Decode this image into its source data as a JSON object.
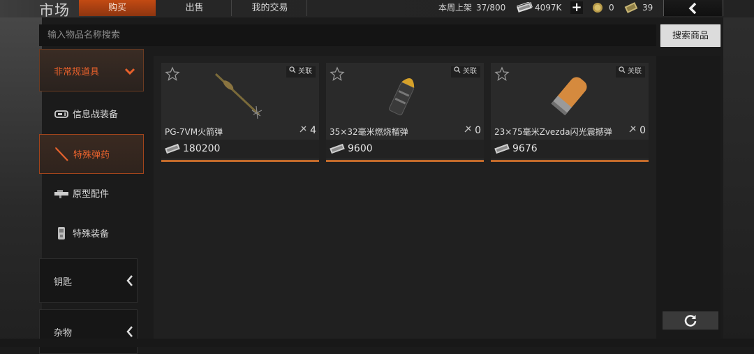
{
  "header": {
    "title": "市场",
    "tabs": [
      {
        "label": "购买",
        "active": true
      },
      {
        "label": "出售",
        "active": false
      },
      {
        "label": "我的交易",
        "active": false
      }
    ],
    "weekly_listed_label": "本周上架",
    "weekly_listed_value": "37/800",
    "currency_amount": "4097K",
    "coin_count": "0",
    "ticket_count": "39",
    "icons": {
      "currency": "cash-icon",
      "coin": "coin-icon",
      "ticket": "ticket-icon",
      "back": "back-arrow-icon"
    }
  },
  "search": {
    "placeholder": "输入物品名称搜索",
    "button_label": "搜索商品"
  },
  "sidebar": {
    "category_title": "非常规道具",
    "items": [
      {
        "label": "信息战装备",
        "icon": "device-icon",
        "active": false
      },
      {
        "label": "特殊弹药",
        "icon": "ammo-icon",
        "active": true
      },
      {
        "label": "原型配件",
        "icon": "attachment-icon",
        "active": false
      },
      {
        "label": "特殊装备",
        "icon": "equipment-icon",
        "active": false
      }
    ],
    "groups": [
      {
        "label": "钥匙"
      },
      {
        "label": "杂物"
      }
    ]
  },
  "listings": [
    {
      "name": "PG-7VM火箭弹",
      "related_label": "关联",
      "stock": "4",
      "price": "180200",
      "icon": "rocket-icon"
    },
    {
      "name": "35×32毫米燃烧榴弹",
      "related_label": "关联",
      "stock": "0",
      "price": "9600",
      "icon": "grenade-round-icon"
    },
    {
      "name": "23×75毫米Zvezda闪光震撼弹",
      "related_label": "关联",
      "stock": "0",
      "price": "9676",
      "icon": "shotgun-shell-icon"
    }
  ],
  "colors": {
    "accent": "#e6622d",
    "price_bar": "#c26a2b",
    "background": "#1b1b1b"
  }
}
